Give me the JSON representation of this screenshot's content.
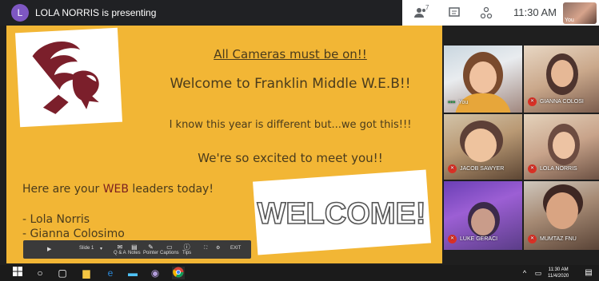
{
  "presenter": {
    "initial": "L",
    "text": "LOLA NORRIS is presenting"
  },
  "top_right": {
    "participants_count": "7",
    "time": "11:30 AM",
    "self_label": "You"
  },
  "slide": {
    "line1": "All Cameras must be on!!",
    "line2": "Welcome to Franklin Middle W.E.B!!",
    "line3": "I know this year is different but...we got this!!!",
    "line4": "We're so excited to meet you!!",
    "leaders_title_prefix": "Here are your ",
    "leaders_title_highlight": "WEB",
    "leaders_title_suffix": " leaders today!",
    "leaders": [
      "- Lola Norris",
      "- Gianna Colosimo"
    ],
    "welcome_text": "WELCOME!"
  },
  "slide_toolbar": {
    "slide_label": "Slide 1",
    "exit_label": "EXIT",
    "tools": [
      "Q & A",
      "Notes",
      "Pointer",
      "Captions",
      "Tips"
    ]
  },
  "participants": [
    {
      "name": "You",
      "muted": false
    },
    {
      "name": "GIANNA COLOSI",
      "muted": true
    },
    {
      "name": "JACOB SAWYER",
      "muted": true
    },
    {
      "name": "LOLA NORRIS",
      "muted": true
    },
    {
      "name": "LUKE GERACI",
      "muted": true
    },
    {
      "name": "MUMTAZ FNU",
      "muted": true
    }
  ],
  "taskbar": {
    "time": "11:30 AM",
    "date": "11/4/2020"
  },
  "colors": {
    "slide_bg": "#f2b635",
    "mute_red": "#d93025",
    "eagle": "#7b1f2b"
  }
}
